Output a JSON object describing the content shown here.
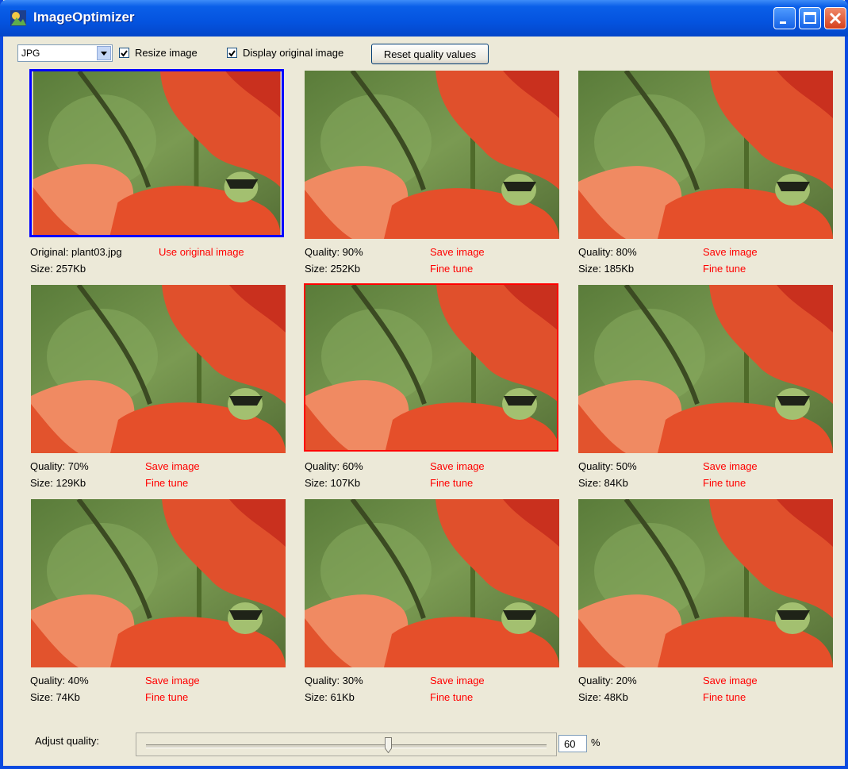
{
  "window": {
    "title": "ImageOptimizer"
  },
  "toolbar": {
    "format": "JPG",
    "resize_checkbox": {
      "label": "Resize image",
      "checked": true
    },
    "display_original_checkbox": {
      "label": "Display original image",
      "checked": true
    },
    "reset_button": "Reset quality values"
  },
  "original": {
    "name": "Original: plant03.jpg",
    "size": "Size: 257Kb",
    "action": "Use original image"
  },
  "variants": [
    {
      "quality": "Quality: 90%",
      "size": "Size: 252Kb",
      "save": "Save image",
      "tune": "Fine tune"
    },
    {
      "quality": "Quality: 80%",
      "size": "Size: 185Kb",
      "save": "Save image",
      "tune": "Fine tune"
    },
    {
      "quality": "Quality: 70%",
      "size": "Size: 129Kb",
      "save": "Save image",
      "tune": "Fine tune"
    },
    {
      "quality": "Quality: 60%",
      "size": "Size: 107Kb",
      "save": "Save image",
      "tune": "Fine tune",
      "selected": true
    },
    {
      "quality": "Quality: 50%",
      "size": "Size: 84Kb",
      "save": "Save image",
      "tune": "Fine tune"
    },
    {
      "quality": "Quality: 40%",
      "size": "Size: 74Kb",
      "save": "Save image",
      "tune": "Fine tune"
    },
    {
      "quality": "Quality: 30%",
      "size": "Size: 61Kb",
      "save": "Save image",
      "tune": "Fine tune"
    },
    {
      "quality": "Quality: 20%",
      "size": "Size: 48Kb",
      "save": "Save image",
      "tune": "Fine tune"
    }
  ],
  "quality_slider": {
    "label": "Adjust quality:",
    "value": "60",
    "unit": "%"
  },
  "colors": {
    "original_border": "#0000ff",
    "selected_border": "#ff0000",
    "link": "#ff0000"
  }
}
